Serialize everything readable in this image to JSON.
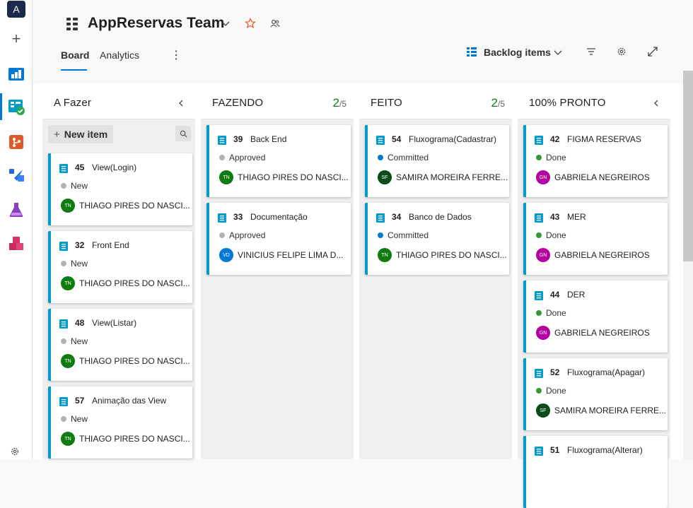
{
  "rail": {
    "logo_letter": "A",
    "add_label": "+"
  },
  "header": {
    "team_title": "AppReservas Team",
    "tabs": [
      {
        "label": "Board"
      },
      {
        "label": "Analytics"
      }
    ],
    "more_label": "⋮",
    "backlog_label": "Backlog items"
  },
  "colors": {
    "accent": "#0078d4",
    "card_bar": "#009ccc",
    "state_new": "#b2b2b2",
    "state_approved": "#b2b2b2",
    "state_committed": "#007acc",
    "state_done": "#339933",
    "avatar_tn": "#107c10",
    "avatar_vd": "#0078d4",
    "avatar_sf": "#0b4a1a",
    "avatar_gn": "#b4009e"
  },
  "columns": [
    {
      "title": "A Fazer",
      "new_item_label": "New item",
      "cards": [
        {
          "id": "45",
          "title": "View(Login)",
          "state": "New",
          "avatar": "TN",
          "assignee": "THIAGO PIRES DO NASCI..."
        },
        {
          "id": "32",
          "title": "Front End",
          "state": "New",
          "avatar": "TN",
          "assignee": "THIAGO PIRES DO NASCI..."
        },
        {
          "id": "48",
          "title": "View(Listar)",
          "state": "New",
          "avatar": "TN",
          "assignee": "THIAGO PIRES DO NASCI..."
        },
        {
          "id": "57",
          "title": "Animação das View",
          "state": "New",
          "avatar": "TN",
          "assignee": "THIAGO PIRES DO NASCI..."
        }
      ]
    },
    {
      "title": "FAZENDO",
      "count": "2",
      "limit": "/5",
      "cards": [
        {
          "id": "39",
          "title": "Back End",
          "state": "Approved",
          "avatar": "TN",
          "assignee": "THIAGO PIRES DO NASCI..."
        },
        {
          "id": "33",
          "title": "Documentação",
          "state": "Approved",
          "avatar": "VD",
          "assignee": "VINICIUS FELIPE LIMA D..."
        }
      ]
    },
    {
      "title": "FEITO",
      "count": "2",
      "limit": "/5",
      "cards": [
        {
          "id": "54",
          "title": "Fluxograma(Cadastrar)",
          "state": "Committed",
          "avatar": "SF",
          "assignee": "SAMIRA MOREIRA FERRE..."
        },
        {
          "id": "34",
          "title": "Banco de Dados",
          "state": "Committed",
          "avatar": "TN",
          "assignee": "THIAGO PIRES DO NASCI..."
        }
      ]
    },
    {
      "title": "100% PRONTO",
      "cards": [
        {
          "id": "42",
          "title": "FIGMA RESERVAS",
          "state": "Done",
          "avatar": "GN",
          "assignee": "GABRIELA NEGREIROS"
        },
        {
          "id": "43",
          "title": "MER",
          "state": "Done",
          "avatar": "GN",
          "assignee": "GABRIELA NEGREIROS"
        },
        {
          "id": "44",
          "title": "DER",
          "state": "Done",
          "avatar": "GN",
          "assignee": "GABRIELA NEGREIROS"
        },
        {
          "id": "52",
          "title": "Fluxograma(Apagar)",
          "state": "Done",
          "avatar": "SF",
          "assignee": "SAMIRA MOREIRA FERRE..."
        },
        {
          "id": "51",
          "title": "Fluxograma(Alterar)",
          "state": "",
          "avatar": "",
          "assignee": ""
        }
      ]
    }
  ]
}
